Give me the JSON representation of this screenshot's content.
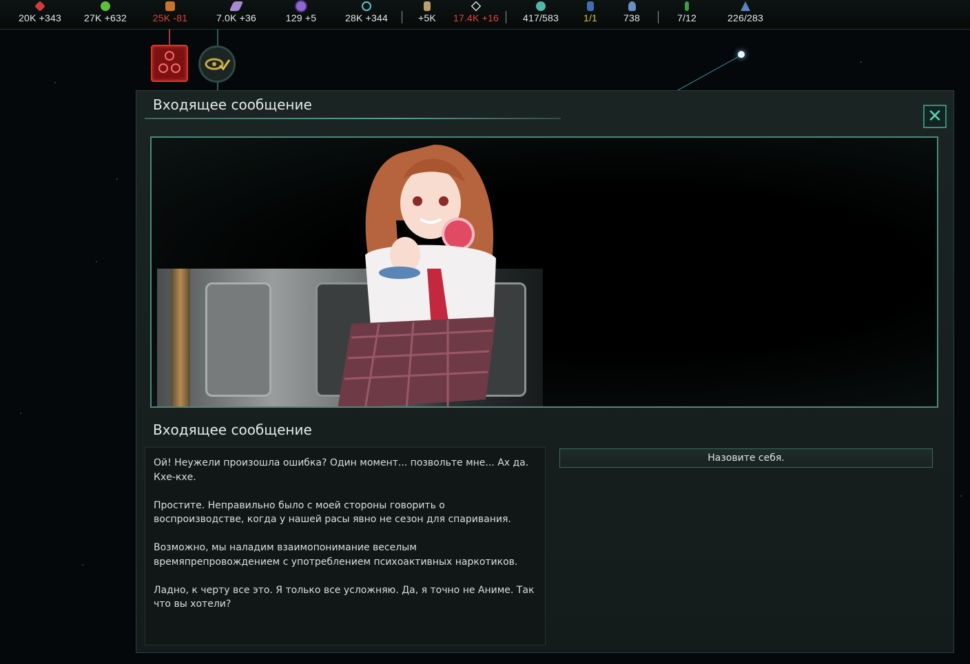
{
  "topbar": {
    "resources": [
      {
        "name": "energy",
        "icon": "red-crystal-icon",
        "value": "20K +343",
        "state": "normal"
      },
      {
        "name": "food",
        "icon": "green-apple-icon",
        "value": "27K +632",
        "state": "normal"
      },
      {
        "name": "consumer-goods",
        "icon": "goods-crate-icon",
        "value": "25K -81",
        "state": "warn"
      },
      {
        "name": "alloys",
        "icon": "purple-ingot-icon",
        "value": "7.0K +36",
        "state": "normal"
      },
      {
        "name": "influence",
        "icon": "purple-orb-icon",
        "value": "129 +5",
        "state": "normal"
      },
      {
        "name": "unity",
        "icon": "unity-ring-icon",
        "value": "28K +344",
        "state": "normal"
      },
      {
        "name": "research",
        "icon": "microscope-icon",
        "value": "+5K",
        "state": "normal"
      },
      {
        "name": "amenities",
        "icon": "diamond-outline-icon",
        "value": "17.4K +16",
        "state": "warn"
      },
      {
        "name": "pops",
        "icon": "planet-cluster-icon",
        "value": "417/583",
        "state": "normal"
      },
      {
        "name": "envoys",
        "icon": "envoy-figure-icon",
        "value": "1/1",
        "state": "amber"
      },
      {
        "name": "population",
        "icon": "person-icon",
        "value": "738",
        "state": "normal"
      },
      {
        "name": "starbases",
        "icon": "antenna-icon",
        "value": "7/12",
        "state": "normal"
      },
      {
        "name": "fleet",
        "icon": "ship-icon",
        "value": "226/283",
        "state": "normal"
      }
    ]
  },
  "dialog": {
    "header_title": "Входящее сообщение",
    "section_title": "Входящее сообщение",
    "paragraphs": [
      "Ой! Неужели произошла ошибка? Один момент... позвольте мне... Ах да. Кхе-кхе.",
      "Простите. Неправильно было с моей стороны говорить о воспроизводстве, когда у нашей расы явно не сезон для спаривания.",
      "Возможно, мы наладим взаимопонимание веселым времяпрепровождением с употреблением психоактивных наркотиков.",
      "Ладно, к черту все это. Я только все усложняю. Да, я точно не Аниме. Так что вы хотели?"
    ],
    "option_label": "Назовите себя.",
    "close_icon": "close-x-icon"
  },
  "colors": {
    "accent": "#4f8a7c",
    "warn": "#e2433d",
    "amber": "#e4c54a",
    "panel": "#1a2422"
  }
}
